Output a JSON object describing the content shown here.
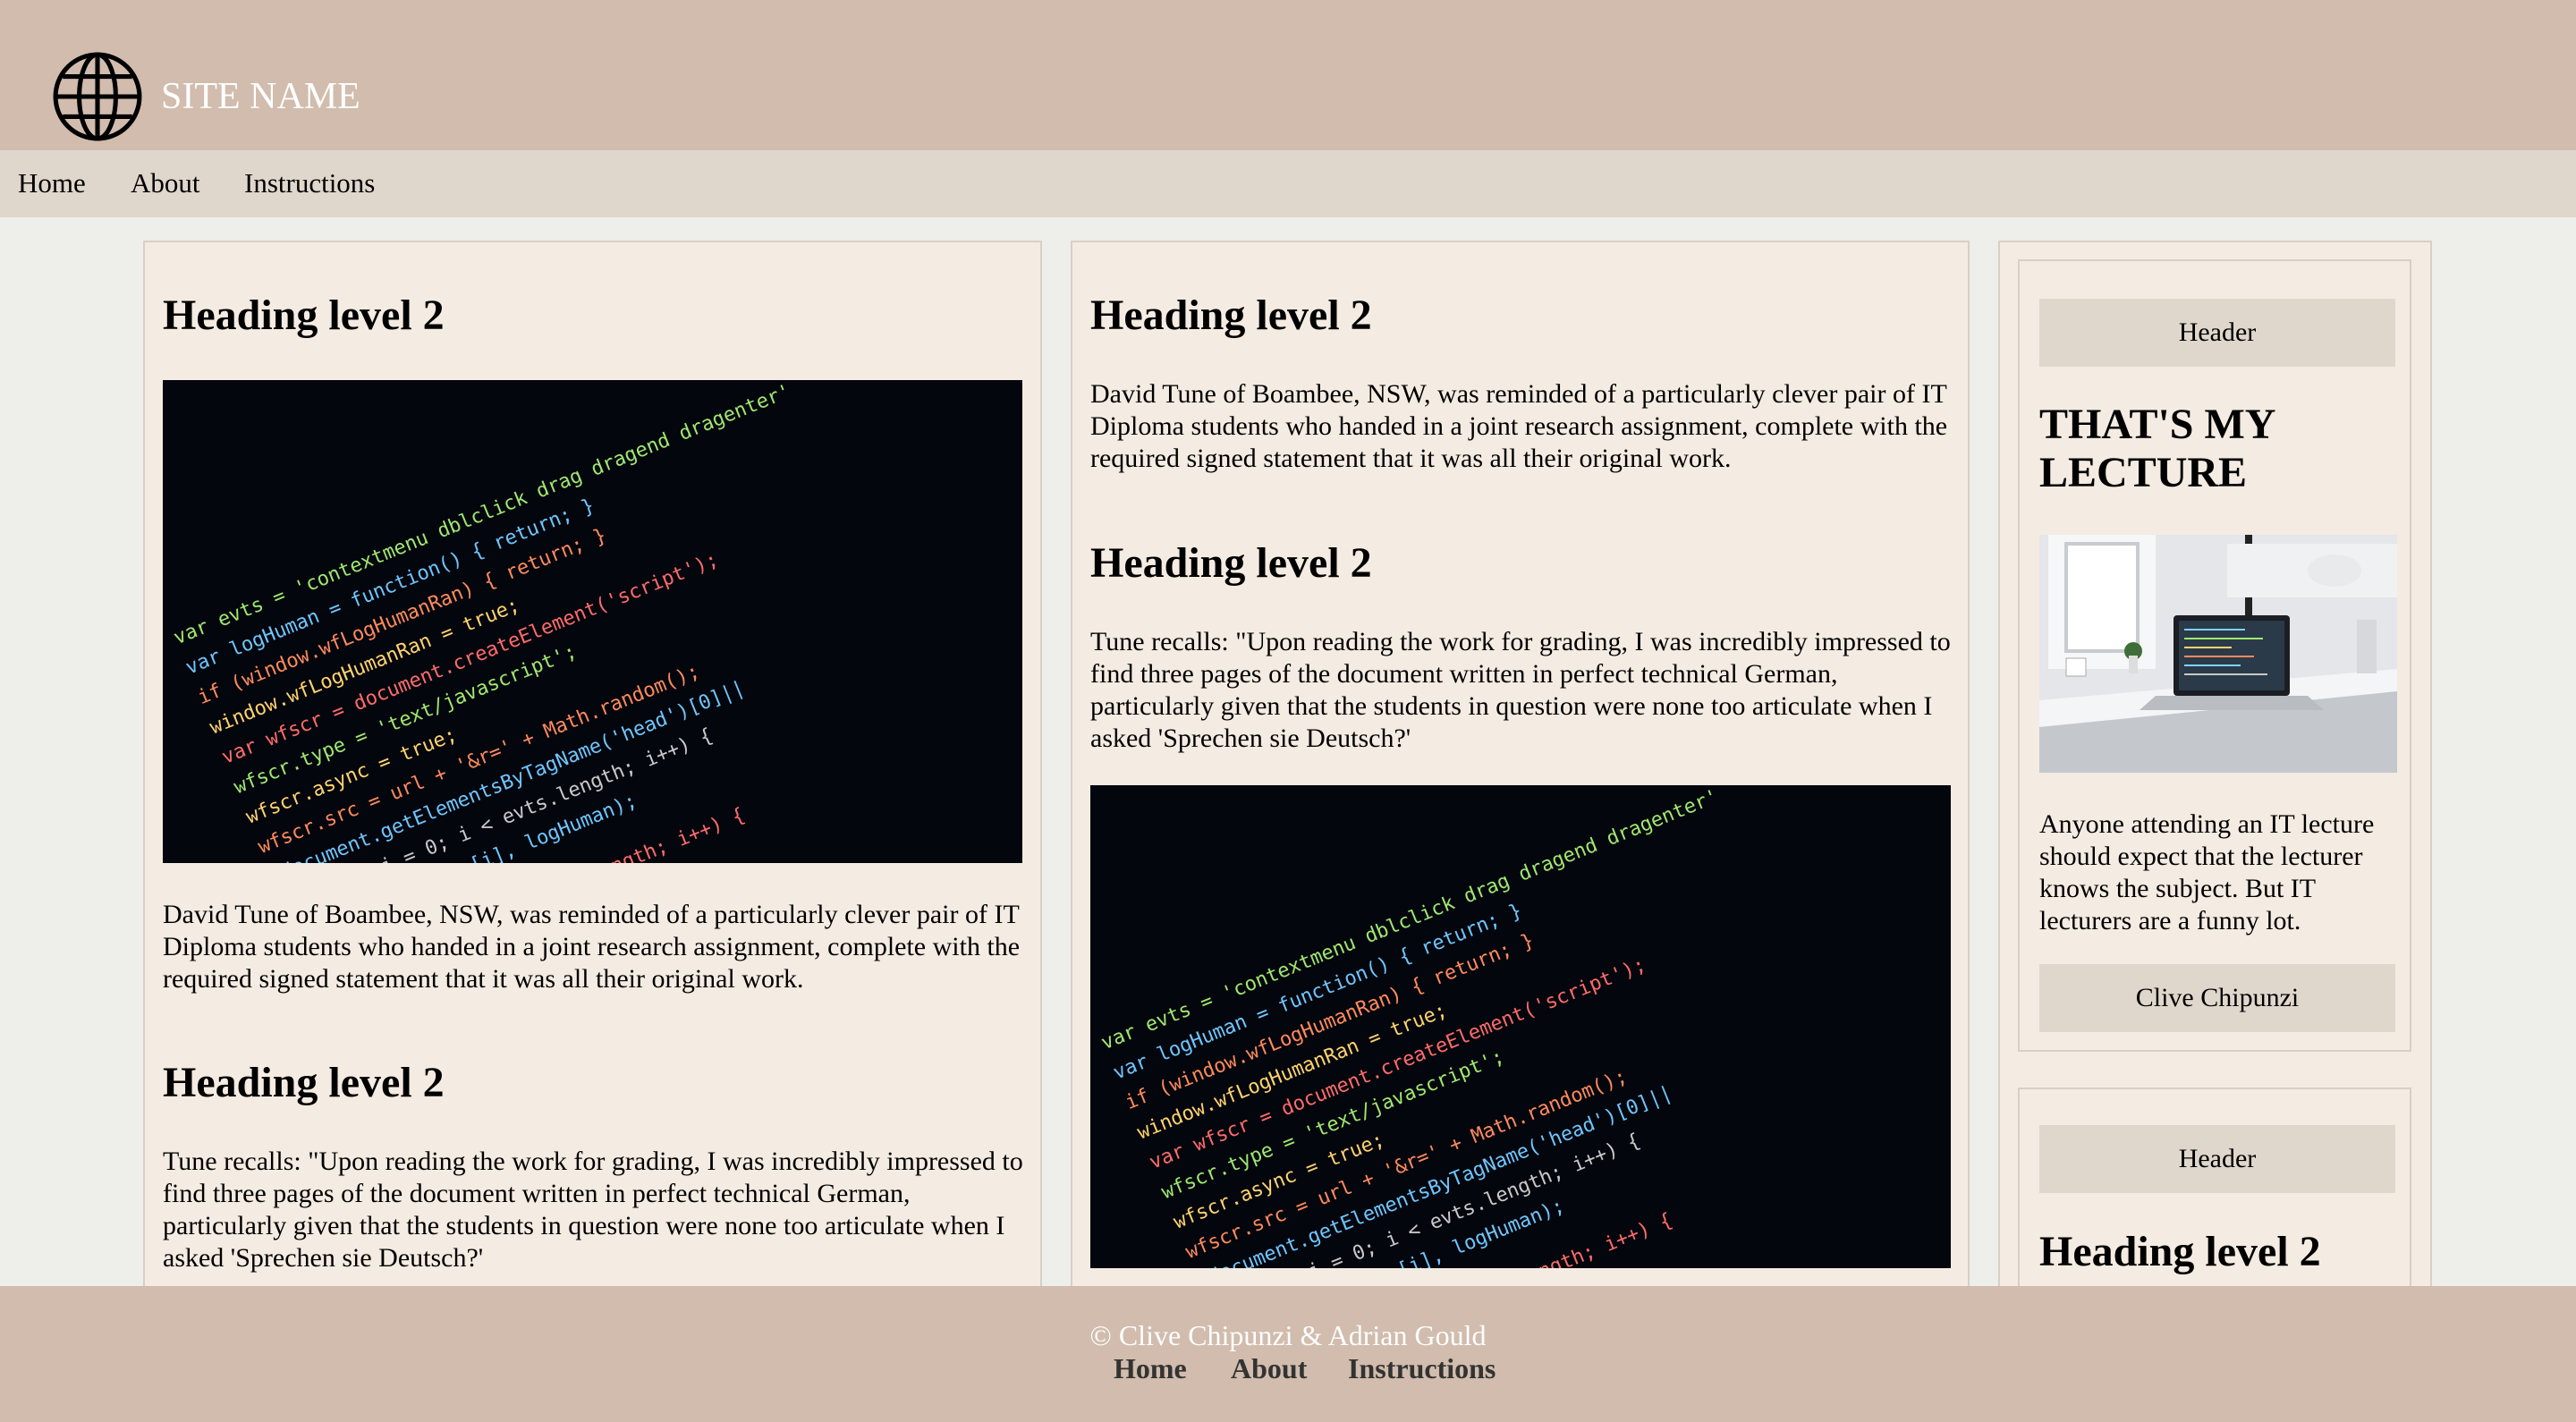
{
  "header": {
    "site_name": "SITE NAME",
    "logo_icon": "globe-icon"
  },
  "nav": [
    "Home",
    "About",
    "Instructions"
  ],
  "column1": {
    "heading1": "Heading level 2",
    "image_icon": "code-screenshot-image",
    "paragraph1": "David Tune of Boambee, NSW, was reminded of a particularly clever pair of IT Diploma students who handed in a joint research assignment, complete with the required signed statement that it was all their original work.",
    "heading2": "Heading level 2",
    "paragraph2": "Tune recalls: \"Upon reading the work for grading, I was incredibly impressed to find three pages of the document written in perfect technical German, particularly given that the students in question were none too articulate when I asked 'Sprechen sie Deutsch?'"
  },
  "column2": {
    "heading1": "Heading level 2",
    "paragraph1": "David Tune of Boambee, NSW, was reminded of a particularly clever pair of IT Diploma students who handed in a joint research assignment, complete with the required signed statement that it was all their original work.",
    "heading2": "Heading level 2",
    "paragraph2": "Tune recalls: \"Upon reading the work for grading, I was incredibly impressed to find three pages of the document written in perfect technical German, particularly given that the students in question were none too articulate when I asked 'Sprechen sie Deutsch?'",
    "image_icon": "code-screenshot-image"
  },
  "sidebar": {
    "card1": {
      "header": "Header",
      "title": "THAT'S MY LECTURE",
      "image_icon": "laptop-desk-photo",
      "text": "Anyone attending an IT lecture should expect that the lecturer knows the subject. But IT lecturers are a funny lot.",
      "footer": "Clive Chipunzi"
    },
    "card2": {
      "header": "Header",
      "title": "Heading level 2"
    }
  },
  "footer": {
    "copyright": "© Clive Chipunzi & Adrian Gould",
    "links": [
      "Home",
      "About",
      "Instructions"
    ]
  },
  "colors": {
    "header_bg": "#d1bcad",
    "nav_bg": "#e0d7cc",
    "panel_bg": "#f4ebe2",
    "page_bg": "#eeeeea"
  }
}
